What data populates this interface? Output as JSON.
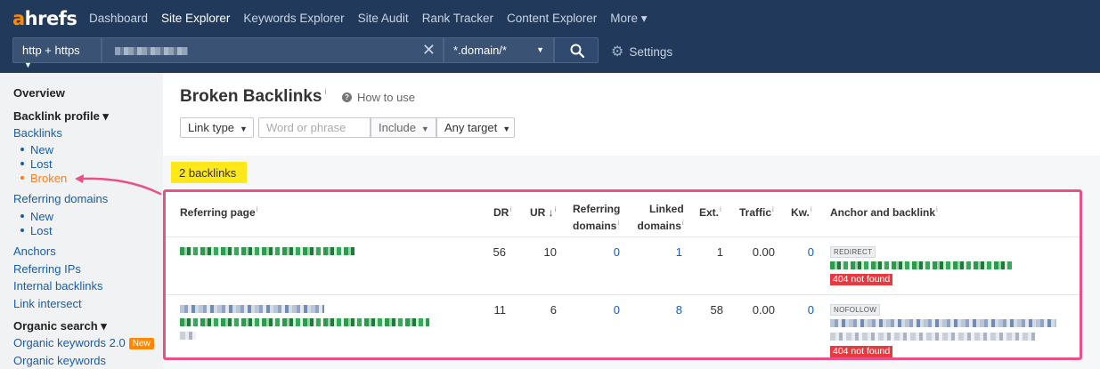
{
  "app": {
    "logo_a": "a",
    "logo_rest": "hrefs"
  },
  "nav": {
    "items": [
      "Dashboard",
      "Site Explorer",
      "Keywords Explorer",
      "Site Audit",
      "Rank Tracker",
      "Content Explorer",
      "More ▾"
    ],
    "active_index": 1
  },
  "search": {
    "protocol": "http + https",
    "mode": "*.domain/*",
    "clear_symbol": "✕",
    "settings_label": "Settings"
  },
  "sidebar": {
    "overview": "Overview",
    "backlink_profile": "Backlink profile ▾",
    "backlinks": "Backlinks",
    "new": "New",
    "lost": "Lost",
    "broken": "Broken",
    "referring_domains": "Referring domains",
    "rd_new": "New",
    "rd_lost": "Lost",
    "anchors": "Anchors",
    "referring_ips": "Referring IPs",
    "internal_backlinks": "Internal backlinks",
    "link_intersect": "Link intersect",
    "organic_search": "Organic search ▾",
    "organic_keywords_2": "Organic keywords 2.0",
    "new_badge": "New",
    "organic_keywords": "Organic keywords"
  },
  "page": {
    "title": "Broken Backlinks",
    "info_mark": "i",
    "how_to_use": "How to use",
    "question_mark": "?"
  },
  "filters": {
    "link_type": "Link type",
    "word_placeholder": "Word or phrase",
    "include": "Include",
    "any_target": "Any target"
  },
  "results": {
    "count_label": "2 backlinks"
  },
  "table": {
    "headers": {
      "referring_page": "Referring page",
      "dr": "DR",
      "ur": "UR ↓",
      "referring_domains_1": "Referring",
      "referring_domains_2": "domains",
      "linked_domains_1": "Linked",
      "linked_domains_2": "domains",
      "ext": "Ext.",
      "traffic": "Traffic",
      "kw": "Kw.",
      "anchor_and_backlink": "Anchor and backlink"
    },
    "rows": [
      {
        "dr": "56",
        "ur": "10",
        "referring_domains": "0",
        "linked_domains": "1",
        "ext": "1",
        "traffic": "0.00",
        "kw": "0",
        "tag": "REDIRECT",
        "status": "404 not found"
      },
      {
        "dr": "11",
        "ur": "6",
        "referring_domains": "0",
        "linked_domains": "8",
        "ext": "58",
        "traffic": "0.00",
        "kw": "0",
        "tag": "NOFOLLOW",
        "status": "404 not found"
      }
    ]
  },
  "colors": {
    "nav_bg": "#213a5c",
    "accent_orange": "#ff8800",
    "highlight_yellow": "#ffe81a",
    "table_outline_pink": "#e8508a",
    "error_red": "#e8393f",
    "link_blue": "#1a5da8"
  },
  "icons": [
    "search-icon",
    "gear-icon",
    "close-icon",
    "question-icon",
    "info-icon",
    "chevron-down-icon",
    "arrow-annotation"
  ]
}
